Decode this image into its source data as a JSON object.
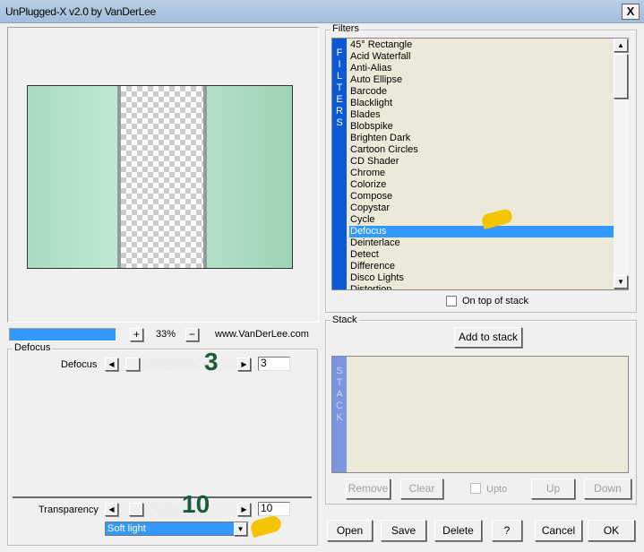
{
  "window": {
    "title": "UnPlugged-X v2.0 by VanDerLee",
    "close_label": "X"
  },
  "preview": {
    "progress_percent": 100,
    "zoom_plus": "+",
    "zoom": "33%",
    "zoom_minus": "−",
    "website": "www.VanDerLee.com"
  },
  "params": {
    "group_title": "Defocus",
    "defocus": {
      "label": "Defocus",
      "value": "3",
      "annotation": "3"
    },
    "transparency": {
      "label": "Transparency",
      "value": "10",
      "annotation": "10"
    },
    "blend_mode": "Soft light"
  },
  "filters": {
    "group_title": "Filters",
    "band_label": [
      "F",
      "I",
      "L",
      "T",
      "E",
      "R",
      "S"
    ],
    "items": [
      "45° Rectangle",
      "Acid Waterfall",
      "Anti-Alias",
      "Auto Ellipse",
      "Barcode",
      "Blacklight",
      "Blades",
      "Blobspike",
      "Brighten Dark",
      "Cartoon Circles",
      "CD Shader",
      "Chrome",
      "Colorize",
      "Compose",
      "Copystar",
      "Cycle",
      "Defocus",
      "Deinterlace",
      "Detect",
      "Difference",
      "Disco Lights",
      "Distortion"
    ],
    "selected": "Defocus",
    "on_top_label": "On top of stack"
  },
  "stack": {
    "group_title": "Stack",
    "add_label": "Add to stack",
    "band_label": [
      "S",
      "T",
      "A",
      "C",
      "K"
    ],
    "remove": "Remove",
    "clear": "Clear",
    "upto": "Upto",
    "up": "Up",
    "down": "Down"
  },
  "buttons": {
    "open": "Open",
    "save": "Save",
    "delete": "Delete",
    "help": "?",
    "cancel": "Cancel",
    "ok": "OK"
  },
  "colors": {
    "selection": "#3399ff",
    "filters_band": "#0a5ad8",
    "annotation": "#1a5c3a"
  }
}
